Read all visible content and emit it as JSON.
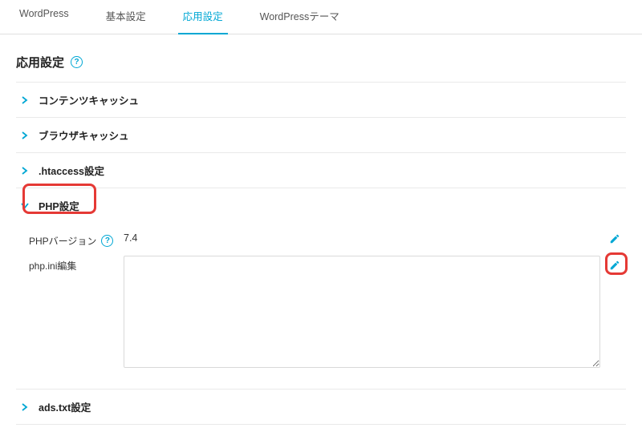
{
  "tabs": {
    "wp": "WordPress",
    "basic": "基本設定",
    "advanced": "応用設定",
    "theme": "WordPressテーマ"
  },
  "page": {
    "title": "応用設定"
  },
  "sections": {
    "content_cache": "コンテンツキャッシュ",
    "browser_cache": "ブラウザキャッシュ",
    "htaccess": ".htaccess設定",
    "php": "PHP設定",
    "adstxt": "ads.txt設定"
  },
  "php": {
    "version_label": "PHPバージョン",
    "version_value": "7.4",
    "ini_label": "php.ini編集",
    "ini_value": ""
  }
}
